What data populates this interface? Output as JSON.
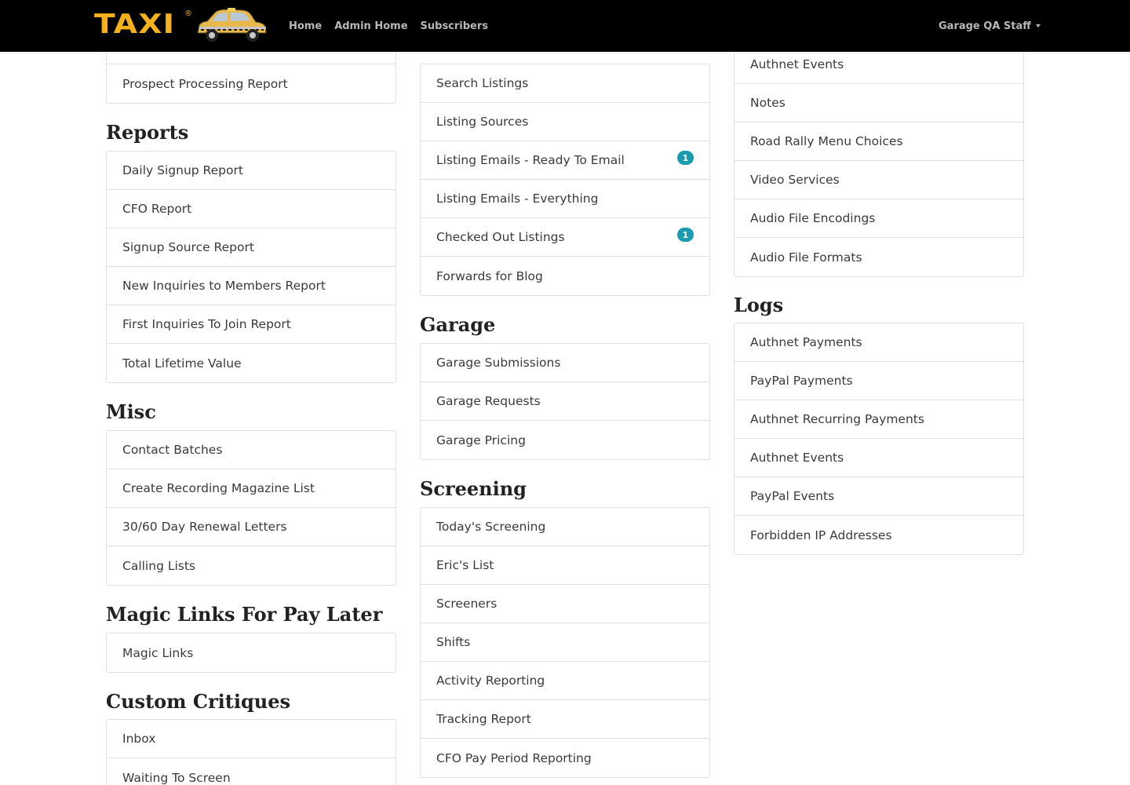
{
  "nav": {
    "logo_text": "TAXI",
    "logo_reg": "®",
    "links": [
      "Home",
      "Admin Home",
      "Subscribers"
    ],
    "user": "Garage QA Staff"
  },
  "col1": {
    "top_items": [
      "",
      "Prospect Processing Report"
    ],
    "reports": {
      "title": "Reports",
      "items": [
        "Daily Signup Report",
        "CFO Report",
        "Signup Source Report",
        "New Inquiries to Members Report",
        "First Inquiries To Join Report",
        "Total Lifetime Value"
      ]
    },
    "misc": {
      "title": "Misc",
      "items": [
        "Contact Batches",
        "Create Recording Magazine List",
        "30/60 Day Renewal Letters",
        "Calling Lists"
      ]
    },
    "magic": {
      "title": "Magic Links For Pay Later",
      "items": [
        "Magic Links"
      ]
    },
    "critiques": {
      "title": "Custom Critiques",
      "items": [
        "Inbox",
        "Waiting To Screen"
      ]
    }
  },
  "col2": {
    "listings_items": [
      "Search Listings",
      "Listing Sources",
      "Listing Emails - Ready To Email",
      "Listing Emails - Everything",
      "Checked Out Listings",
      "Forwards for Blog"
    ],
    "listings_badges": {
      "ready_to_email": "1",
      "checked_out": "1"
    },
    "garage": {
      "title": "Garage",
      "items": [
        "Garage Submissions",
        "Garage Requests",
        "Garage Pricing"
      ]
    },
    "screening": {
      "title": "Screening",
      "items": [
        "Today's Screening",
        "Eric's List",
        "Screeners",
        "Shifts",
        "Activity Reporting",
        "Tracking Report",
        "CFO Pay Period Reporting"
      ]
    }
  },
  "col3": {
    "top_items": [
      "Authnet Events",
      "Notes",
      "Road Rally Menu Choices",
      "Video Services",
      "Audio File Encodings",
      "Audio File Formats"
    ],
    "logs": {
      "title": "Logs",
      "items": [
        "Authnet Payments",
        "PayPal Payments",
        "Authnet Recurring Payments",
        "Authnet Events",
        "PayPal Events",
        "Forbidden IP Addresses"
      ]
    }
  }
}
